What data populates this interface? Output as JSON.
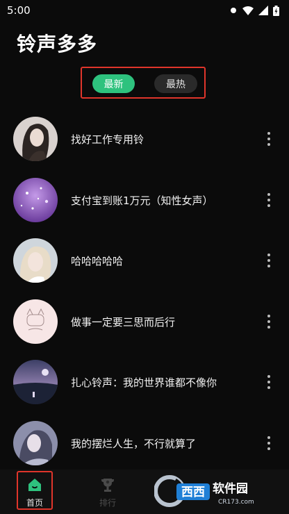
{
  "status_bar": {
    "time": "5:00"
  },
  "app": {
    "title": "铃声多多"
  },
  "tabs": [
    {
      "label": "最新",
      "active": true
    },
    {
      "label": "最热",
      "active": false
    }
  ],
  "ringtones": [
    {
      "title": "找好工作专用铃"
    },
    {
      "title": "支付宝到账1万元（知性女声）"
    },
    {
      "title": "哈哈哈哈哈"
    },
    {
      "title": "做事一定要三思而后行"
    },
    {
      "title": "扎心铃声：我的世界谁都不像你"
    },
    {
      "title": "我的摆烂人生，不行就算了"
    }
  ],
  "bottom_nav": [
    {
      "label": "首页",
      "icon": "home-icon",
      "active": true
    },
    {
      "label": "排行",
      "icon": "trophy-icon",
      "active": false
    }
  ],
  "watermark": {
    "brand": "西西软件园",
    "site": "CR173.com"
  },
  "colors": {
    "accent": "#2ec27e",
    "highlight_box": "#e0352b",
    "background": "#0b0b0b"
  }
}
